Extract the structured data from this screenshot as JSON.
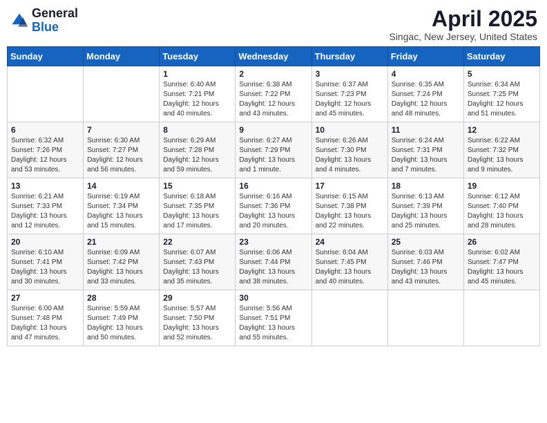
{
  "logo": {
    "general": "General",
    "blue": "Blue"
  },
  "header": {
    "month": "April 2025",
    "location": "Singac, New Jersey, United States"
  },
  "weekdays": [
    "Sunday",
    "Monday",
    "Tuesday",
    "Wednesday",
    "Thursday",
    "Friday",
    "Saturday"
  ],
  "weeks": [
    [
      {
        "day": "",
        "sunrise": "",
        "sunset": "",
        "daylight": ""
      },
      {
        "day": "",
        "sunrise": "",
        "sunset": "",
        "daylight": ""
      },
      {
        "day": "1",
        "sunrise": "Sunrise: 6:40 AM",
        "sunset": "Sunset: 7:21 PM",
        "daylight": "Daylight: 12 hours and 40 minutes."
      },
      {
        "day": "2",
        "sunrise": "Sunrise: 6:38 AM",
        "sunset": "Sunset: 7:22 PM",
        "daylight": "Daylight: 12 hours and 43 minutes."
      },
      {
        "day": "3",
        "sunrise": "Sunrise: 6:37 AM",
        "sunset": "Sunset: 7:23 PM",
        "daylight": "Daylight: 12 hours and 45 minutes."
      },
      {
        "day": "4",
        "sunrise": "Sunrise: 6:35 AM",
        "sunset": "Sunset: 7:24 PM",
        "daylight": "Daylight: 12 hours and 48 minutes."
      },
      {
        "day": "5",
        "sunrise": "Sunrise: 6:34 AM",
        "sunset": "Sunset: 7:25 PM",
        "daylight": "Daylight: 12 hours and 51 minutes."
      }
    ],
    [
      {
        "day": "6",
        "sunrise": "Sunrise: 6:32 AM",
        "sunset": "Sunset: 7:26 PM",
        "daylight": "Daylight: 12 hours and 53 minutes."
      },
      {
        "day": "7",
        "sunrise": "Sunrise: 6:30 AM",
        "sunset": "Sunset: 7:27 PM",
        "daylight": "Daylight: 12 hours and 56 minutes."
      },
      {
        "day": "8",
        "sunrise": "Sunrise: 6:29 AM",
        "sunset": "Sunset: 7:28 PM",
        "daylight": "Daylight: 12 hours and 59 minutes."
      },
      {
        "day": "9",
        "sunrise": "Sunrise: 6:27 AM",
        "sunset": "Sunset: 7:29 PM",
        "daylight": "Daylight: 13 hours and 1 minute."
      },
      {
        "day": "10",
        "sunrise": "Sunrise: 6:26 AM",
        "sunset": "Sunset: 7:30 PM",
        "daylight": "Daylight: 13 hours and 4 minutes."
      },
      {
        "day": "11",
        "sunrise": "Sunrise: 6:24 AM",
        "sunset": "Sunset: 7:31 PM",
        "daylight": "Daylight: 13 hours and 7 minutes."
      },
      {
        "day": "12",
        "sunrise": "Sunrise: 6:22 AM",
        "sunset": "Sunset: 7:32 PM",
        "daylight": "Daylight: 13 hours and 9 minutes."
      }
    ],
    [
      {
        "day": "13",
        "sunrise": "Sunrise: 6:21 AM",
        "sunset": "Sunset: 7:33 PM",
        "daylight": "Daylight: 13 hours and 12 minutes."
      },
      {
        "day": "14",
        "sunrise": "Sunrise: 6:19 AM",
        "sunset": "Sunset: 7:34 PM",
        "daylight": "Daylight: 13 hours and 15 minutes."
      },
      {
        "day": "15",
        "sunrise": "Sunrise: 6:18 AM",
        "sunset": "Sunset: 7:35 PM",
        "daylight": "Daylight: 13 hours and 17 minutes."
      },
      {
        "day": "16",
        "sunrise": "Sunrise: 6:16 AM",
        "sunset": "Sunset: 7:36 PM",
        "daylight": "Daylight: 13 hours and 20 minutes."
      },
      {
        "day": "17",
        "sunrise": "Sunrise: 6:15 AM",
        "sunset": "Sunset: 7:38 PM",
        "daylight": "Daylight: 13 hours and 22 minutes."
      },
      {
        "day": "18",
        "sunrise": "Sunrise: 6:13 AM",
        "sunset": "Sunset: 7:39 PM",
        "daylight": "Daylight: 13 hours and 25 minutes."
      },
      {
        "day": "19",
        "sunrise": "Sunrise: 6:12 AM",
        "sunset": "Sunset: 7:40 PM",
        "daylight": "Daylight: 13 hours and 28 minutes."
      }
    ],
    [
      {
        "day": "20",
        "sunrise": "Sunrise: 6:10 AM",
        "sunset": "Sunset: 7:41 PM",
        "daylight": "Daylight: 13 hours and 30 minutes."
      },
      {
        "day": "21",
        "sunrise": "Sunrise: 6:09 AM",
        "sunset": "Sunset: 7:42 PM",
        "daylight": "Daylight: 13 hours and 33 minutes."
      },
      {
        "day": "22",
        "sunrise": "Sunrise: 6:07 AM",
        "sunset": "Sunset: 7:43 PM",
        "daylight": "Daylight: 13 hours and 35 minutes."
      },
      {
        "day": "23",
        "sunrise": "Sunrise: 6:06 AM",
        "sunset": "Sunset: 7:44 PM",
        "daylight": "Daylight: 13 hours and 38 minutes."
      },
      {
        "day": "24",
        "sunrise": "Sunrise: 6:04 AM",
        "sunset": "Sunset: 7:45 PM",
        "daylight": "Daylight: 13 hours and 40 minutes."
      },
      {
        "day": "25",
        "sunrise": "Sunrise: 6:03 AM",
        "sunset": "Sunset: 7:46 PM",
        "daylight": "Daylight: 13 hours and 43 minutes."
      },
      {
        "day": "26",
        "sunrise": "Sunrise: 6:02 AM",
        "sunset": "Sunset: 7:47 PM",
        "daylight": "Daylight: 13 hours and 45 minutes."
      }
    ],
    [
      {
        "day": "27",
        "sunrise": "Sunrise: 6:00 AM",
        "sunset": "Sunset: 7:48 PM",
        "daylight": "Daylight: 13 hours and 47 minutes."
      },
      {
        "day": "28",
        "sunrise": "Sunrise: 5:59 AM",
        "sunset": "Sunset: 7:49 PM",
        "daylight": "Daylight: 13 hours and 50 minutes."
      },
      {
        "day": "29",
        "sunrise": "Sunrise: 5:57 AM",
        "sunset": "Sunset: 7:50 PM",
        "daylight": "Daylight: 13 hours and 52 minutes."
      },
      {
        "day": "30",
        "sunrise": "Sunrise: 5:56 AM",
        "sunset": "Sunset: 7:51 PM",
        "daylight": "Daylight: 13 hours and 55 minutes."
      },
      {
        "day": "",
        "sunrise": "",
        "sunset": "",
        "daylight": ""
      },
      {
        "day": "",
        "sunrise": "",
        "sunset": "",
        "daylight": ""
      },
      {
        "day": "",
        "sunrise": "",
        "sunset": "",
        "daylight": ""
      }
    ]
  ]
}
